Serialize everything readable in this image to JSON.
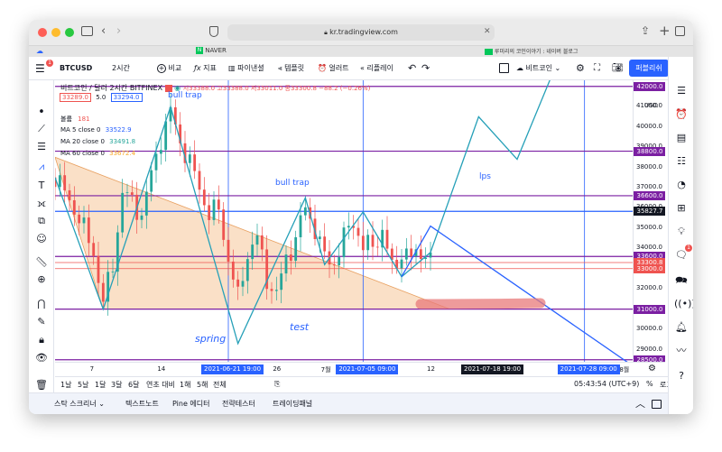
{
  "browser": {
    "url": "kr.tradingview.com",
    "tab_naver": "NAVER",
    "tab_right": "루미리의 코인이야기 : 네이버 블로그"
  },
  "toolbar": {
    "symbol": "BTCUSD",
    "interval": "2시간",
    "compare": "비교",
    "indicators": "지표",
    "financials": "파이낸셜",
    "templates": "템플릿",
    "alert": "얼러트",
    "replay": "리플레이",
    "chart_name": "비트코인",
    "publish": "퍼블리쉬"
  },
  "left_badge": "1",
  "right_badge": "1",
  "legend": {
    "title": "비트코인 / 달러  2시간  BITFINEX",
    "ohlc": "시33388.0 고33388.0 저33011.0 종33300.8 −88.2 (−0.26%)",
    "bid": "33289.0",
    "spread": "5.0",
    "ask": "33294.0",
    "volume_label": "볼륨",
    "volume_value": "181",
    "ma5_label": "MA 5 close 0",
    "ma5_value": "33522.9",
    "ma20_label": "MA 20 close 0",
    "ma20_value": "33491.8",
    "ma60_label": "MA 60 close 0",
    "ma60_value": "33672.4"
  },
  "annotations": {
    "bull_trap_1": "bull trap",
    "bull_trap_2": "bull trap",
    "spring": "spring",
    "test": "test",
    "lps": "lps"
  },
  "price_scale": {
    "currency": "USD",
    "ticks": [
      "41000.0",
      "40000.0",
      "39000.0",
      "38000.0",
      "37000.0",
      "36000.0",
      "35000.0",
      "34000.0",
      "32000.0",
      "31000.0",
      "30000.0",
      "29000.0"
    ],
    "labels": [
      {
        "text": "42000.0",
        "color": "#7b1fa2"
      },
      {
        "text": "38800.0",
        "color": "#7b1fa2"
      },
      {
        "text": "36600.0",
        "color": "#7b1fa2"
      },
      {
        "text": "35827.7",
        "color": "#131722"
      },
      {
        "text": "33600.0",
        "color": "#7b1fa2"
      },
      {
        "text": "33300.8",
        "color": "#ef5350"
      },
      {
        "text": "33000.0",
        "color": "#ef5350"
      },
      {
        "text": "31000.0",
        "color": "#7b1fa2"
      },
      {
        "text": "28500.0",
        "color": "#7b1fa2"
      }
    ]
  },
  "time_axis": {
    "ticks": [
      "7",
      "14",
      "26",
      "7월",
      "12",
      "8월"
    ],
    "labels": [
      {
        "text": "2021-06-21  19:00",
        "color": "#2962ff"
      },
      {
        "text": "2021-07-05  09:00",
        "color": "#2962ff"
      },
      {
        "text": "2021-07-18  19:00",
        "color": "#131722"
      },
      {
        "text": "2021-07-28  09:00",
        "color": "#2962ff"
      }
    ]
  },
  "range_bar": {
    "ranges": [
      "1날",
      "5날",
      "1달",
      "3달",
      "6달",
      "연초 대비",
      "1해",
      "5해",
      "전체"
    ],
    "clock": "05:43:54 (UTC+9)",
    "percent": "%",
    "log": "로그",
    "auto": "자동"
  },
  "bottom_tabs": [
    "스탁 스크리너",
    "텍스트노트",
    "Pine 에디터",
    "전략테스터",
    "트레이딩패널"
  ],
  "colors": {
    "up": "#26a69a",
    "down": "#ef5350",
    "purple": "#7b1fa2",
    "blue": "#2962ff",
    "teal": "#26a0b8",
    "wedge": "#f5c699",
    "publish": "#2962ff"
  },
  "chart_data": {
    "type": "candlestick",
    "symbol": "BTCUSD",
    "exchange": "BITFINEX",
    "interval": "2h",
    "ylim": [
      28400,
      42300
    ],
    "x_range": [
      "2021-06-03",
      "2021-08-02"
    ],
    "price_path": [
      [
        "2021-06-03",
        37500
      ],
      [
        "2021-06-05",
        36000
      ],
      [
        "2021-06-07",
        33800
      ],
      [
        "2021-06-08",
        31300
      ],
      [
        "2021-06-09",
        33200
      ],
      [
        "2021-06-10",
        36800
      ],
      [
        "2021-06-12",
        35700
      ],
      [
        "2021-06-14",
        39500
      ],
      [
        "2021-06-15",
        40700
      ],
      [
        "2021-06-16",
        39300
      ],
      [
        "2021-06-17",
        38200
      ],
      [
        "2021-06-18",
        37000
      ],
      [
        "2021-06-19",
        35700
      ],
      [
        "2021-06-20",
        35900
      ],
      [
        "2021-06-21",
        33500
      ],
      [
        "2021-06-22",
        31500
      ],
      [
        "2021-06-23",
        33800
      ],
      [
        "2021-06-24",
        34500
      ],
      [
        "2021-06-25",
        32500
      ],
      [
        "2021-06-26",
        31700
      ],
      [
        "2021-06-27",
        33500
      ],
      [
        "2021-06-28",
        34500
      ],
      [
        "2021-06-29",
        36000
      ],
      [
        "2021-06-30",
        35000
      ],
      [
        "2021-07-01",
        33500
      ],
      [
        "2021-07-02",
        33300
      ],
      [
        "2021-07-03",
        34500
      ],
      [
        "2021-07-04",
        35400
      ],
      [
        "2021-07-05",
        34000
      ],
      [
        "2021-07-06",
        34200
      ],
      [
        "2021-07-07",
        34800
      ],
      [
        "2021-07-08",
        33000
      ],
      [
        "2021-07-09",
        33800
      ],
      [
        "2021-07-10",
        33500
      ],
      [
        "2021-07-11",
        34000
      ],
      [
        "2021-07-12",
        33300
      ]
    ],
    "horizontal_levels": [
      {
        "price": 42000,
        "color": "purple"
      },
      {
        "price": 38800,
        "color": "purple"
      },
      {
        "price": 36600,
        "color": "purple"
      },
      {
        "price": 35827.7,
        "color": "blue"
      },
      {
        "price": 33600,
        "color": "purple"
      },
      {
        "price": 33300.8,
        "color": "red"
      },
      {
        "price": 33000,
        "color": "red"
      },
      {
        "price": 31000,
        "color": "purple"
      },
      {
        "price": 28500,
        "color": "purple"
      }
    ],
    "vertical_lines": [
      "2021-06-21",
      "2021-07-05",
      "2021-07-28"
    ],
    "projection_teal": [
      [
        "2021-06-03",
        37500
      ],
      [
        "2021-06-08",
        31000
      ],
      [
        "2021-06-15",
        41000
      ],
      [
        "2021-06-22",
        29300
      ],
      [
        "2021-06-29",
        36500
      ],
      [
        "2021-07-01",
        33200
      ],
      [
        "2021-07-05",
        35800
      ],
      [
        "2021-07-09",
        32600
      ],
      [
        "2021-07-12",
        33800
      ],
      [
        "2021-07-17",
        40500
      ],
      [
        "2021-07-21",
        38400
      ],
      [
        "2021-07-25",
        43000
      ]
    ],
    "projection_blue": [
      [
        "2021-07-09",
        32600
      ],
      [
        "2021-07-12",
        35100
      ],
      [
        "2021-08-02",
        28200
      ]
    ],
    "wedge": [
      [
        "2021-06-03",
        38500
      ],
      [
        "2021-07-14",
        31000
      ],
      [
        "2021-06-08",
        31000
      ]
    ]
  }
}
